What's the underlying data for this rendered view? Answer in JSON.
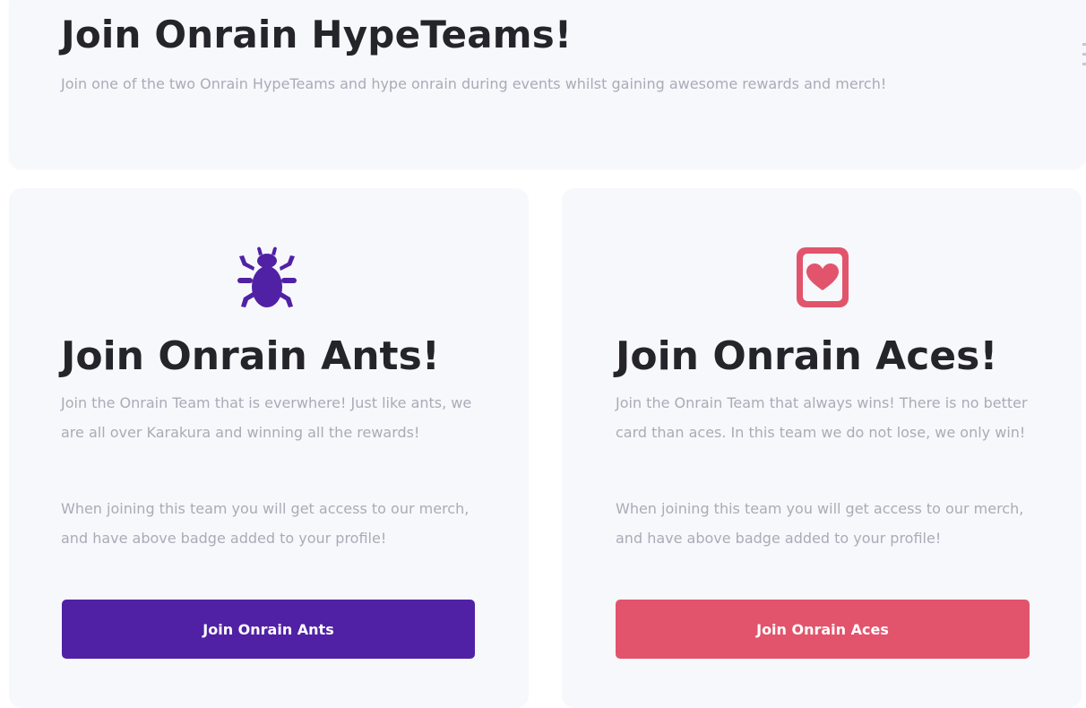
{
  "hero": {
    "title": "Join Onrain HypeTeams!",
    "subtitle": "Join one of the two Onrain HypeTeams and hype onrain during events whilst gaining awesome rewards and merch!"
  },
  "teams": [
    {
      "icon": "bug-icon",
      "accent_color": "#5021a5",
      "title": "Join Onrain Ants!",
      "description": "Join the Onrain Team that is everwhere! Just like ants, we are all over Karakura and winning all the rewards!",
      "note": "When joining this team you will get access to our merch, and have above badge added to your profile!",
      "button_label": "Join Onrain Ants"
    },
    {
      "icon": "heart-card-icon",
      "accent_color": "#e2546c",
      "title": "Join Onrain Aces!",
      "description": "Join the Onrain Team that always wins! There is no better card than aces. In this team we do not lose, we only win!",
      "note": "When joining this team you will get access to our merch, and have above badge added to your profile!",
      "button_label": "Join Onrain Aces"
    }
  ]
}
